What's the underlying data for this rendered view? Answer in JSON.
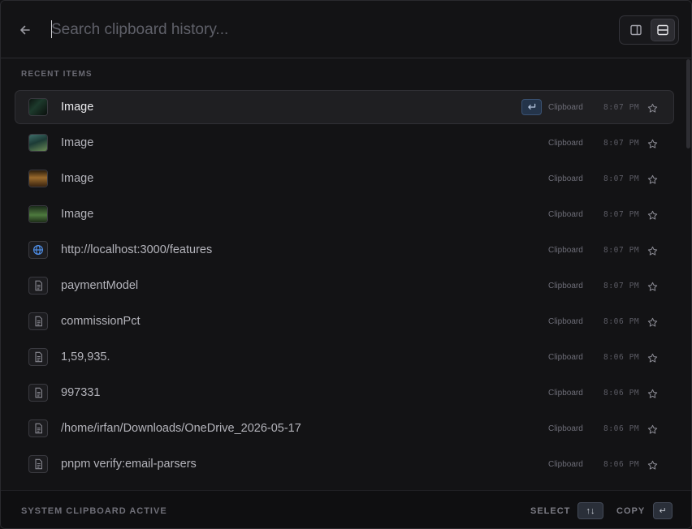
{
  "search": {
    "placeholder": "Search clipboard history..."
  },
  "header": {
    "back_icon": "arrow-left-icon",
    "view_modes": [
      {
        "name": "split-view",
        "icon": "sidebar-icon",
        "active": false
      },
      {
        "name": "stacked-view",
        "icon": "rows-icon",
        "active": true
      }
    ]
  },
  "section": {
    "label": "RECENT ITEMS"
  },
  "items": [
    {
      "type": "image",
      "thumb": "dark-green",
      "text": "Image",
      "source": "Clipboard",
      "time": "8:07 PM",
      "selected": true
    },
    {
      "type": "image",
      "thumb": "teal",
      "text": "Image",
      "source": "Clipboard",
      "time": "8:07 PM",
      "selected": false
    },
    {
      "type": "image",
      "thumb": "amber",
      "text": "Image",
      "source": "Clipboard",
      "time": "8:07 PM",
      "selected": false
    },
    {
      "type": "image",
      "thumb": "green",
      "text": "Image",
      "source": "Clipboard",
      "time": "8:07 PM",
      "selected": false
    },
    {
      "type": "link",
      "text": "http://localhost:3000/features",
      "source": "Clipboard",
      "time": "8:07 PM",
      "selected": false
    },
    {
      "type": "text",
      "text": "paymentModel",
      "source": "Clipboard",
      "time": "8:07 PM",
      "selected": false
    },
    {
      "type": "text",
      "text": "commissionPct",
      "source": "Clipboard",
      "time": "8:06 PM",
      "selected": false
    },
    {
      "type": "text",
      "text": "1,59,935.",
      "source": "Clipboard",
      "time": "8:06 PM",
      "selected": false
    },
    {
      "type": "text",
      "text": "997331",
      "source": "Clipboard",
      "time": "8:06 PM",
      "selected": false
    },
    {
      "type": "text",
      "text": "/home/irfan/Downloads/OneDrive_2026-05-17",
      "source": "Clipboard",
      "time": "8:06 PM",
      "selected": false
    },
    {
      "type": "text",
      "text": "pnpm verify:email-parsers",
      "source": "Clipboard",
      "time": "8:06 PM",
      "selected": false
    }
  ],
  "footer": {
    "status": "SYSTEM CLIPBOARD ACTIVE",
    "select_label": "SELECT",
    "select_key": "↑↓",
    "copy_label": "COPY",
    "copy_key": "↵"
  },
  "colors": {
    "background": "#131315",
    "selected_row": "#1f1f22",
    "accent_badge": "#24344a",
    "link_icon": "#4f8fe8"
  }
}
